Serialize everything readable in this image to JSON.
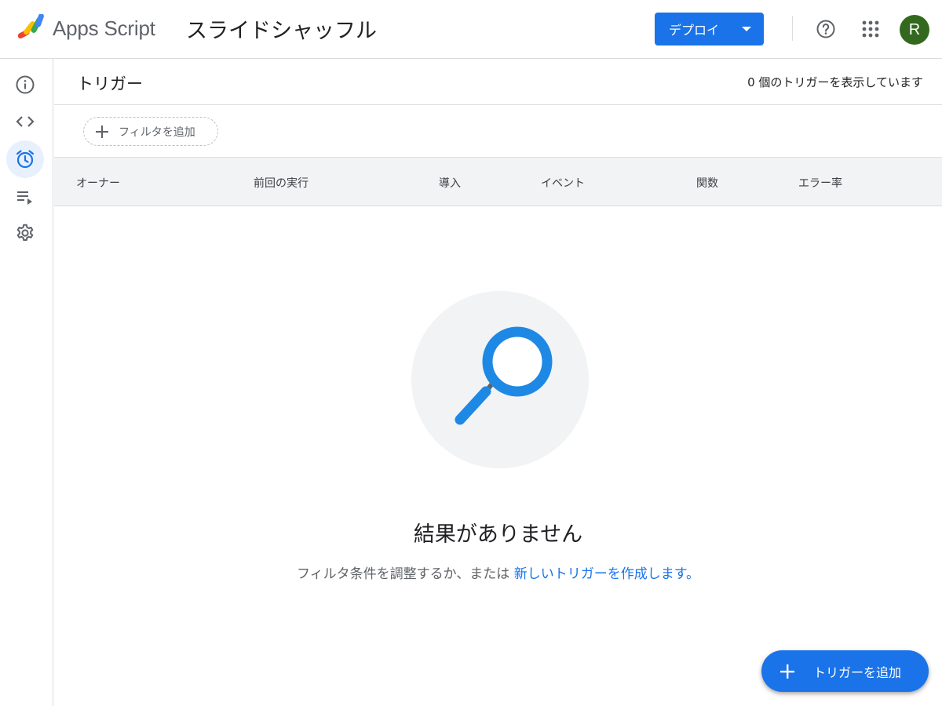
{
  "header": {
    "app_name": "Apps Script",
    "project_title": "スライドシャッフル",
    "deploy_label": "デプロイ",
    "avatar_initial": "R"
  },
  "sidebar": {
    "items": [
      {
        "icon": "info-icon",
        "active": false
      },
      {
        "icon": "code-icon",
        "active": false
      },
      {
        "icon": "alarm-clock-icon",
        "active": true
      },
      {
        "icon": "playlist-play-icon",
        "active": false
      },
      {
        "icon": "gear-icon",
        "active": false
      }
    ]
  },
  "page": {
    "title": "トリガー",
    "trigger_count": "0 個のトリガーを表示しています",
    "filter_label": "フィルタを追加"
  },
  "table": {
    "columns": [
      "オーナー",
      "前回の実行",
      "導入",
      "イベント",
      "関数",
      "エラー率"
    ]
  },
  "empty_state": {
    "title": "結果がありません",
    "subtitle": "フィルタ条件を調整するか、または",
    "link": "新しいトリガーを作成します。"
  },
  "fab": {
    "label": "トリガーを追加"
  },
  "colors": {
    "accent": "#1a73e8",
    "avatar": "#33691e",
    "active_bg": "#e8f0fe",
    "search_icon": "#1e88e5"
  }
}
